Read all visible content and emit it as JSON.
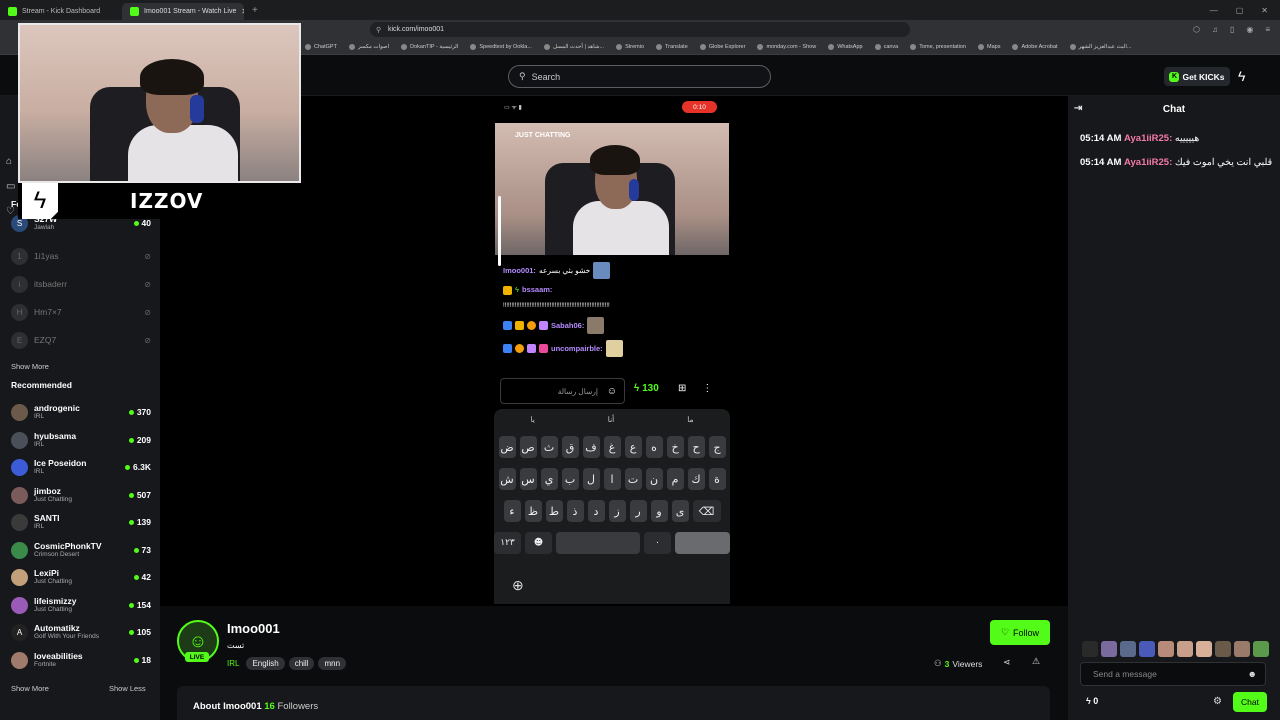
{
  "browser": {
    "tabs": [
      {
        "title": "Stream - Kick Dashboard"
      },
      {
        "title": "Imoo001 Stream - Watch Live"
      }
    ],
    "url": "kick.com/imoo001",
    "bookmarks": [
      "ChatGPT",
      "اصوات مكسر",
      "DokanTIP - الرئيسية",
      "Speedtest by Ookla...",
      "شاهد | أحدث المسل...",
      "Stremio",
      "Translate",
      "Globe Explorer",
      "monday.com - Show",
      "WhatsApp",
      "canva",
      "Tome, presentation",
      "Maps",
      "Adobe Acrobat",
      "البث عبدالعزيز الشهر..."
    ]
  },
  "header": {
    "search_placeholder": "Search",
    "get_kicks": "Get KICKs"
  },
  "overlay": {
    "brand_name": "IZZOV"
  },
  "sidebar": {
    "following_label": "Fo",
    "following": [
      {
        "name": "S27W",
        "category": "Jawlah",
        "viewers": "40",
        "live": true
      },
      {
        "name": "1i1yas",
        "live": false
      },
      {
        "name": "itsbaderr",
        "live": false
      },
      {
        "name": "Hm7×7",
        "live": false
      },
      {
        "name": "EZQ7",
        "live": false
      }
    ],
    "show_more": "Show More",
    "recommended_title": "Recommended",
    "recommended": [
      {
        "name": "androgenic",
        "category": "IRL",
        "viewers": "370"
      },
      {
        "name": "hyubsama",
        "category": "IRL",
        "viewers": "209"
      },
      {
        "name": "Ice Poseidon",
        "category": "IRL",
        "viewers": "6.3K"
      },
      {
        "name": "jimboz",
        "category": "Just Chatting",
        "viewers": "507"
      },
      {
        "name": "SANTI",
        "category": "IRL",
        "viewers": "139"
      },
      {
        "name": "CosmicPhonkTV",
        "category": "Crimson Desert",
        "viewers": "73"
      },
      {
        "name": "LexiPi",
        "category": "Just Chatting",
        "viewers": "42"
      },
      {
        "name": "lifeismizzy",
        "category": "Just Chatting",
        "viewers": "154"
      },
      {
        "name": "Automatikz",
        "category": "Golf With Your Friends",
        "viewers": "105"
      },
      {
        "name": "loveabilities",
        "category": "Fortnite",
        "viewers": "18"
      }
    ],
    "show_more_bottom": "Show More",
    "show_less": "Show Less"
  },
  "phone": {
    "rec_time": "0:10",
    "category_overlay": "JUST CHATTING",
    "chat": [
      {
        "user": "Imoo001:",
        "text": "خشو بثي بسرعه",
        "color": "#b68cff"
      },
      {
        "user": "bssaam:",
        "text": "!!!!!!!!!!!!!!!!!!!!!!!!!!!!!!!!!!!!!!!!!!!!!!!!!!!!!!!!!!!!!!!!",
        "color": "#b68cff"
      },
      {
        "user": "Sabah06:",
        "text": "",
        "color": "#b68cff"
      },
      {
        "user": "uncompairble:",
        "text": "",
        "color": "#b68cff"
      }
    ],
    "input_placeholder": "إرسال رسالة",
    "kicks": "130",
    "suggestions": [
      "يا",
      "أنا",
      "ما"
    ],
    "keyboard_rows": [
      [
        "ض",
        "ص",
        "ث",
        "ق",
        "ف",
        "غ",
        "ع",
        "ه",
        "خ",
        "ح",
        "ج"
      ],
      [
        "ش",
        "س",
        "ي",
        "ب",
        "ل",
        "ا",
        "ت",
        "ن",
        "م",
        "ك",
        "ة"
      ],
      [
        "ء",
        "ظ",
        "ط",
        "ذ",
        "د",
        "ز",
        "ر",
        "و",
        "ى",
        "⌫"
      ]
    ],
    "num_key": "١٢٣",
    "dot_key": "۰"
  },
  "channel": {
    "name": "Imoo001",
    "live_label": "LIVE",
    "title": "تست",
    "category": "IRL",
    "tags": [
      "English",
      "chill",
      "mnn"
    ],
    "follow_label": "Follow",
    "viewers": "3",
    "viewers_label": "Viewers",
    "about_label": "About Imoo001",
    "followers_count": "16",
    "followers_label": "Followers"
  },
  "chat": {
    "title": "Chat",
    "messages": [
      {
        "time": "05:14 AM",
        "user": "Aya1iiR25:",
        "text": "هيييييه"
      },
      {
        "time": "05:14 AM",
        "user": "Aya1iiR25:",
        "text": "قلبي انت يخي اموت فيك"
      }
    ],
    "input_placeholder": "Send a message",
    "kicks": "0",
    "send_label": "Chat"
  },
  "colors": {
    "accent": "#53fc18",
    "chat_user": "#f47ba8",
    "background": "#0b0c0d",
    "panel": "#17181b"
  }
}
